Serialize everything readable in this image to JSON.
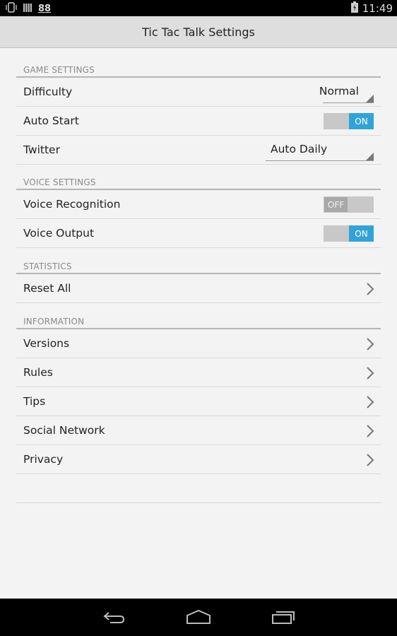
{
  "status_bar": {
    "left_icons": [
      "phone-vibrate-icon",
      "signal-bars-icon",
      "notification-88-icon"
    ],
    "notification_count": "88",
    "battery_state": "charging",
    "time": "11:49"
  },
  "action_bar": {
    "title": "Tic Tac Talk Settings"
  },
  "sections": {
    "game": {
      "title": "GAME SETTINGS",
      "difficulty": {
        "label": "Difficulty",
        "value": "Normal"
      },
      "auto_start": {
        "label": "Auto Start",
        "state": "ON"
      },
      "twitter": {
        "label": "Twitter",
        "value": "Auto Daily"
      }
    },
    "voice": {
      "title": "VOICE SETTINGS",
      "recognition": {
        "label": "Voice Recognition",
        "state": "OFF"
      },
      "output": {
        "label": "Voice Output",
        "state": "ON"
      }
    },
    "statistics": {
      "title": "STATISTICS",
      "reset": {
        "label": "Reset All"
      }
    },
    "information": {
      "title": "INFORMATION",
      "items": [
        {
          "label": "Versions"
        },
        {
          "label": "Rules"
        },
        {
          "label": "Tips"
        },
        {
          "label": "Social Network"
        },
        {
          "label": "Privacy"
        }
      ]
    }
  },
  "colors": {
    "toggle_on": "#33a3d6",
    "toggle_off_knob": "#a8a8a8",
    "toggle_track": "#c8c8c8",
    "action_bar": "#dedede",
    "background": "#f3f3f3"
  },
  "nav_bar": {
    "buttons": [
      "back-icon",
      "home-icon",
      "recent-apps-icon"
    ]
  }
}
